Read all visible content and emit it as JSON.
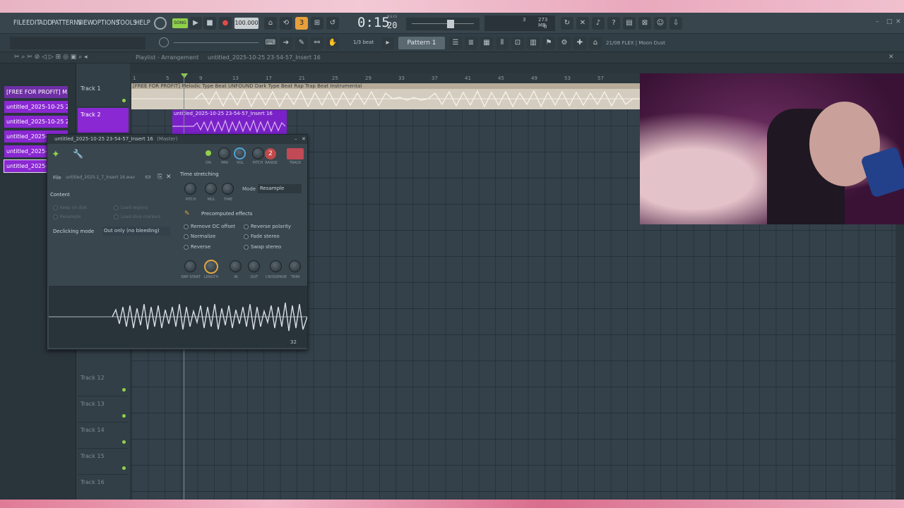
{
  "menu": {
    "items": [
      "FILE",
      "EDIT",
      "ADD",
      "PATTERNS",
      "VIEW",
      "OPTIONS",
      "TOOLS",
      "HELP"
    ]
  },
  "transport": {
    "song_label": "SONG",
    "tempo": "100.000",
    "time": "0:15",
    "time_sub": "20",
    "time_unit": "M:S:CS",
    "pattern": "Pattern 1",
    "snap": "1/3 beat",
    "cpu": "273 MB",
    "voices": "3",
    "zero": "0"
  },
  "status": {
    "hint": "21/08  FLEX | Moon Dust"
  },
  "playlist": {
    "title": "Playlist - Arrangement",
    "breadcrumb": "untitled_2025-10-25 23-54-57_Insert 16"
  },
  "picker": {
    "items": [
      "[FREE FOR PROFIT] M...",
      "untitled_2025-10-25 23-...",
      "untitled_2025-10-25 23-...",
      "untitled_2025-3",
      "untitled_2025-3",
      "untitled_2025-3"
    ]
  },
  "ruler": [
    "1",
    "5",
    "9",
    "13",
    "17",
    "21",
    "25",
    "29",
    "33",
    "37",
    "41",
    "45",
    "49",
    "53",
    "57"
  ],
  "tracks": [
    {
      "name": "Track 1"
    },
    {
      "name": "Track 2"
    },
    {
      "name": "Track 12"
    },
    {
      "name": "Track 13"
    },
    {
      "name": "Track 14"
    },
    {
      "name": "Track 15"
    },
    {
      "name": "Track 16"
    }
  ],
  "clips": {
    "clip1": "[FREE FOR PROFIT] Melodic Type Beat UNFOUND Dark Type Beat  Rap Trap Beat Instrumental",
    "clip2": "untitled_2025-10-25 23-54-57_Insert 16"
  },
  "plugin": {
    "title": "untitled_2025-10-25 23-54-57_Insert 16",
    "title_suffix": "(Master)",
    "file_label": "File",
    "file_value": "untitled_2025-1_7_Insert 16.wav",
    "track_num": "2",
    "knob_labels": {
      "on": "ON",
      "pan": "PAN",
      "vol": "VOL",
      "pitch": "PITCH",
      "range": "RANGE",
      "track": "TRACK"
    },
    "time_stretching": "Time stretching",
    "ts_knobs": [
      "PITCH",
      "MUL",
      "TIME"
    ],
    "mode_label": "Mode",
    "mode_value": "Resample",
    "content_label": "Content",
    "content_opts": [
      "Keep on disk",
      "Resample",
      "Load regions",
      "Load slice markers"
    ],
    "declicking_label": "Declicking mode",
    "declicking_value": "Out only (no bleeding)",
    "precomputed": "Precomputed effects",
    "effects": [
      "Remove DC offset",
      "Normalize",
      "Reverse",
      "Reverse polarity",
      "Fade stereo",
      "Swap stereo"
    ],
    "bottom_knobs": [
      "SMP START",
      "LENGTH",
      "IN",
      "OUT",
      "CROSSFADE",
      "TRIM"
    ],
    "wave_zoom": "32"
  }
}
